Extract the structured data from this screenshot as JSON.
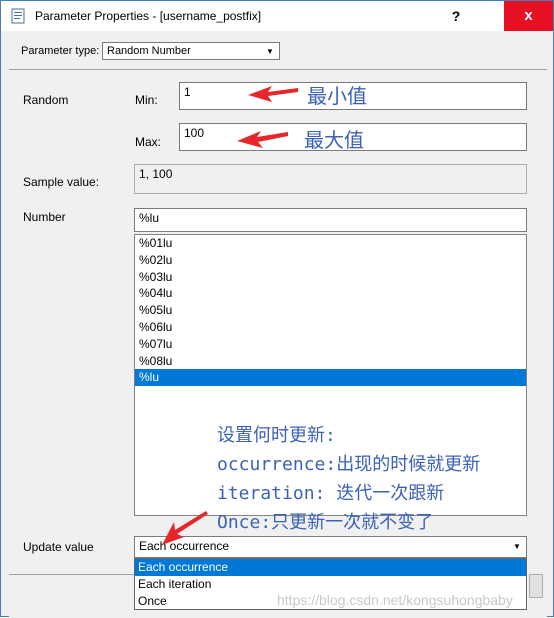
{
  "window": {
    "title": "Parameter Properties - [username_postfix]",
    "help_label": "?",
    "close_label": "x"
  },
  "param_type": {
    "label": "Parameter type:",
    "value": "Random Number"
  },
  "random": {
    "label": "Random",
    "min_label": "Min:",
    "min_value": "1",
    "max_label": "Max:",
    "max_value": "100"
  },
  "sample": {
    "label": "Sample value:",
    "value": "1, 100"
  },
  "number": {
    "label": "Number",
    "value": "%lu",
    "options": [
      "%01lu",
      "%02lu",
      "%03lu",
      "%04lu",
      "%05lu",
      "%06lu",
      "%07lu",
      "%08lu",
      "%lu"
    ],
    "selected": "%lu"
  },
  "update": {
    "label": "Update value",
    "value": "Each occurrence",
    "options": [
      "Each occurrence",
      "Each iteration",
      "Once"
    ]
  },
  "annotations": {
    "min_note": "最小值",
    "max_note": "最大值",
    "line1": "设置何时更新:",
    "line2": "occurrence:出现的时候就更新",
    "line3": "iteration: 迭代一次跟新",
    "line4": "Once:只更新一次就不变了",
    "color": "#3b62b6",
    "arrow_color": "#e8262a"
  },
  "watermark": "https://blog.csdn.net/kongsuhongbaby"
}
